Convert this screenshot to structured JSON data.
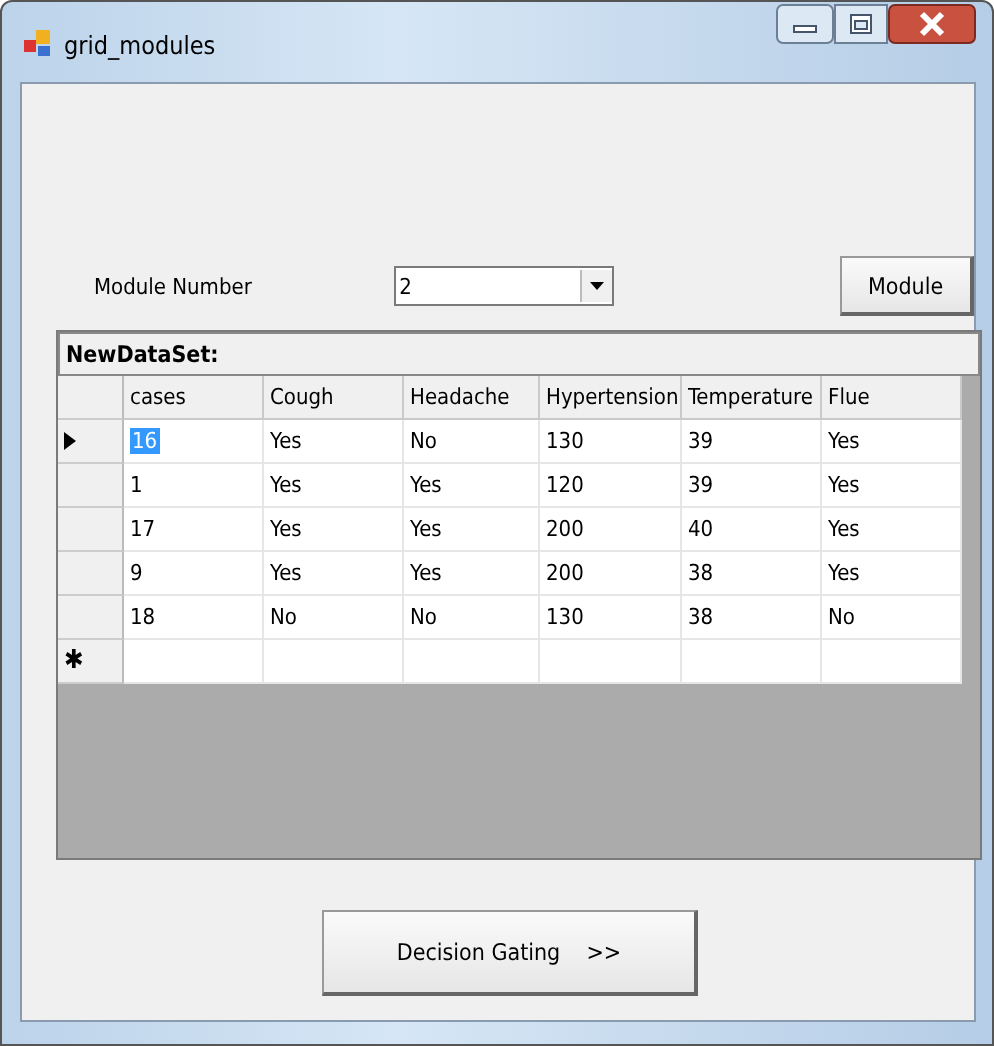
{
  "window": {
    "title": "grid_modules"
  },
  "module_label": "Module Number",
  "module_combo": {
    "value": "2"
  },
  "module_button": "Module",
  "grid": {
    "caption": "NewDataSet:",
    "columns": [
      "cases",
      "Cough",
      "Headache",
      "Hypertension",
      "Temperature",
      "Flue"
    ],
    "rows": [
      {
        "selected": true,
        "cells": [
          "16",
          "Yes",
          "No",
          "130",
          "39",
          "Yes"
        ]
      },
      {
        "selected": false,
        "cells": [
          "1",
          "Yes",
          "Yes",
          "120",
          "39",
          "Yes"
        ]
      },
      {
        "selected": false,
        "cells": [
          "17",
          "Yes",
          "Yes",
          "200",
          "40",
          "Yes"
        ]
      },
      {
        "selected": false,
        "cells": [
          "9",
          "Yes",
          "Yes",
          "200",
          "38",
          "Yes"
        ]
      },
      {
        "selected": false,
        "cells": [
          "18",
          "No",
          "No",
          "130",
          "38",
          "No"
        ]
      }
    ],
    "new_row_marker": "✱"
  },
  "decision_button": "Decision Gating    >>"
}
